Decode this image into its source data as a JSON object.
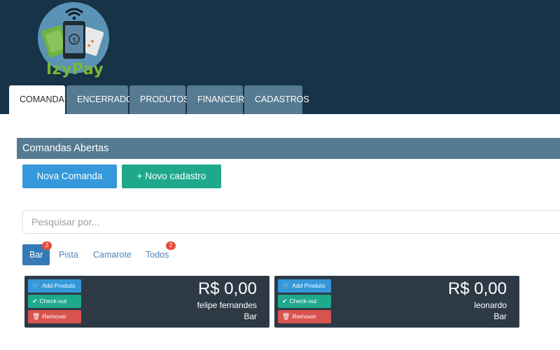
{
  "brand": {
    "name": "IzyPay"
  },
  "tabs": [
    {
      "label": "COMANDAS",
      "active": true
    },
    {
      "label": "ENCERRADOS",
      "active": false
    },
    {
      "label": "PRODUTOS",
      "active": false
    },
    {
      "label": "FINANCEIRO",
      "active": false
    },
    {
      "label": "CADASTROS",
      "active": false
    }
  ],
  "panel": {
    "title": "Comandas Abertas"
  },
  "actions": {
    "new_order": "Nova Comanda",
    "new_register": "+ Novo cadastro"
  },
  "search": {
    "placeholder": "Pesquisar por..."
  },
  "filters": [
    {
      "label": "Bar",
      "active": true,
      "badge": "2"
    },
    {
      "label": "Pista",
      "active": false
    },
    {
      "label": "Camarote",
      "active": false
    },
    {
      "label": "Todos",
      "active": false,
      "badge": "2"
    }
  ],
  "card_buttons": {
    "add": "Add Produto",
    "checkout": "Check-out",
    "remove": "Remover"
  },
  "orders": [
    {
      "amount": "R$ 0,00",
      "name": "felipe fernandes",
      "location": "Bar"
    },
    {
      "amount": "R$ 0,00",
      "name": "leonardo",
      "location": "Bar"
    }
  ],
  "colors": {
    "header_bg": "#163347",
    "tab_bg": "#557a91",
    "primary": "#3498db",
    "success": "#1fa98c",
    "danger": "#d9534f",
    "card_bg": "#2d3a46",
    "badge": "#e74c3c"
  }
}
